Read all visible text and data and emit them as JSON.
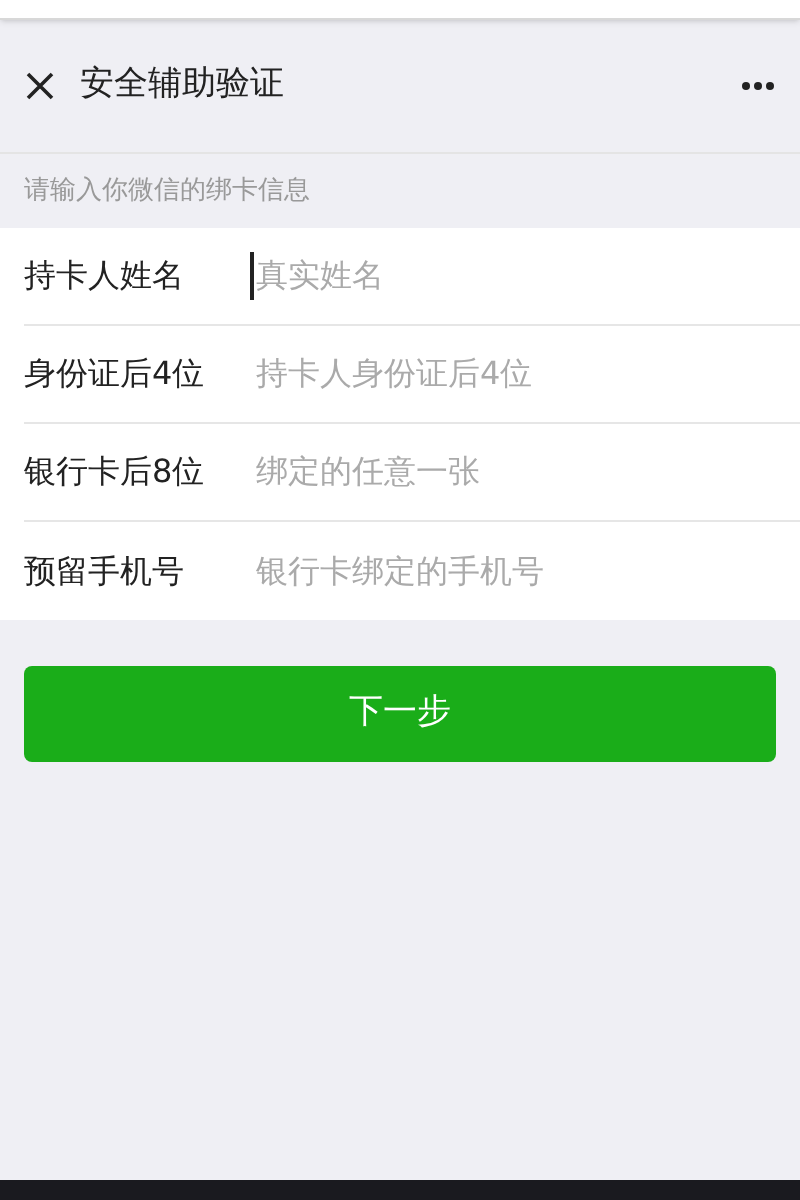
{
  "header": {
    "title": "安全辅助验证"
  },
  "hint": "请输入你微信的绑卡信息",
  "fields": [
    {
      "label": "持卡人姓名",
      "placeholder": "真实姓名",
      "focused": true
    },
    {
      "label": "身份证后4位",
      "placeholder": "持卡人身份证后4位",
      "focused": false
    },
    {
      "label": "银行卡后8位",
      "placeholder": "绑定的任意一张",
      "focused": false
    },
    {
      "label": "预留手机号",
      "placeholder": "银行卡绑定的手机号",
      "focused": false
    }
  ],
  "next_button": "下一步"
}
